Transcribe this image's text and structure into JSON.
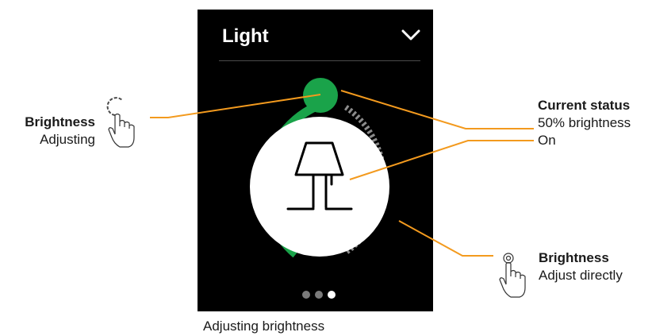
{
  "screen": {
    "title": "Light",
    "dropdown_icon": "chevron-down-icon",
    "device_icon": "lamp-icon",
    "page_indicator": {
      "count": 3,
      "active_index": 2
    },
    "brightness_level": 0.5,
    "colors": {
      "background": "#000000",
      "accent": "#1aa34a",
      "track": "#8c8c8c",
      "dial_face": "#ffffff"
    }
  },
  "caption": "Adjusting brightness",
  "annotations": {
    "left": {
      "title": "Brightness",
      "text": "Adjusting",
      "icon": "rotate-gesture-icon"
    },
    "right": {
      "title": "Current status",
      "line1": "50% brightness",
      "line2": "On"
    },
    "bottom": {
      "title": "Brightness",
      "text": "Adjust directly",
      "icon": "tap-gesture-icon"
    },
    "leader_color": "#f39a1e"
  }
}
